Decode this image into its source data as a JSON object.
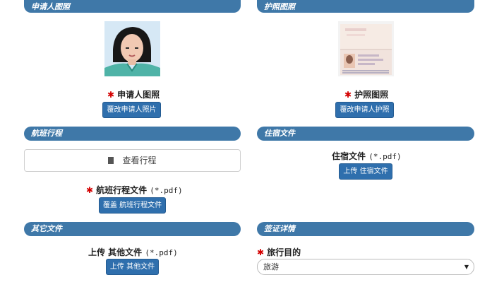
{
  "sections": {
    "applicant_photo": "申请人图照",
    "passport_photo": "护照图照",
    "flight_itinerary": "航班行程",
    "accommodation_docs": "住宿文件",
    "other_docs": "其它文件",
    "visa_details": "签证详情"
  },
  "applicant": {
    "label": "申请人图照",
    "button": "覆改申请人照片"
  },
  "passport": {
    "label": "护照图照",
    "button": "覆改申请人护照"
  },
  "flight": {
    "view_label": "查看行程",
    "file_label": "航班行程文件",
    "file_ext": "(*.pdf)",
    "button": "覆盖 航班行程文件"
  },
  "accommodation": {
    "file_label": "住宿文件",
    "file_ext": "(*.pdf)",
    "button": "上传 住宿文件"
  },
  "other": {
    "file_label": "上传 其他文件",
    "file_ext": "(*.pdf)",
    "button": "上传 其他文件"
  },
  "visa": {
    "purpose_label": "旅行目的",
    "purpose_value": "旅游"
  },
  "icons": {
    "required": "asterisk",
    "view": "document-icon",
    "dropdown": "caret-down-icon"
  },
  "colors": {
    "section_bar": "#3f78a8",
    "button": "#2f6fad",
    "required": "#d40000"
  }
}
